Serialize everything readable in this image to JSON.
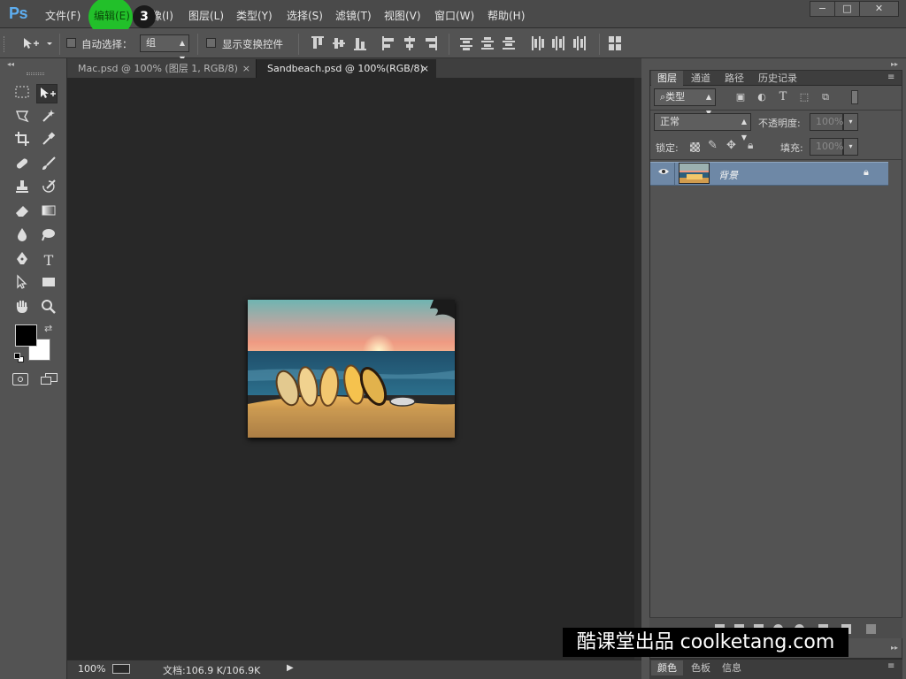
{
  "app": {
    "logo": "Ps"
  },
  "menu": [
    "文件(F)",
    "编辑(E)",
    "图像(I)",
    "图层(L)",
    "类型(Y)",
    "选择(S)",
    "滤镜(T)",
    "视图(V)",
    "窗口(W)",
    "帮助(H)"
  ],
  "tutorial": {
    "step_number": "3"
  },
  "window_controls": {
    "minimize": "−",
    "restore": "□",
    "close": "✕"
  },
  "options_bar": {
    "auto_select_label": "自动选择：",
    "auto_select_checked": false,
    "target_value": "组",
    "show_transform_label": "显示变换控件",
    "show_transform_checked": false
  },
  "tools": [
    "move-tool",
    "rectangular-marquee-tool",
    "lasso-tool",
    "magic-wand-tool",
    "crop-tool",
    "eyedropper-tool",
    "spot-healing-tool",
    "brush-tool",
    "clone-stamp-tool",
    "history-brush-tool",
    "eraser-tool",
    "gradient-tool",
    "blur-tool",
    "dodge-tool",
    "pen-tool",
    "type-tool",
    "path-selection-tool",
    "rectangle-tool",
    "hand-tool",
    "zoom-tool"
  ],
  "colors": {
    "foreground": "#000000",
    "background": "#ffffff",
    "layer_selected": "#6e88a6",
    "highlight": "#22c02a"
  },
  "documents": {
    "tabs": [
      {
        "label": "Mac.psd @ 100% (图层 1, RGB/8)",
        "close": "×",
        "active": false
      },
      {
        "label": "Sandbeach.psd @ 100%(RGB/8)",
        "close": "×",
        "active": true
      }
    ]
  },
  "status": {
    "zoom": "100%",
    "doc_info": "文档:106.9 K/106.9K"
  },
  "panels": {
    "tabs": [
      "图层",
      "通道",
      "路径",
      "历史记录"
    ],
    "filter_kind": "类型",
    "blend_mode": "正常",
    "opacity_label": "不透明度:",
    "opacity_value": "100%",
    "lock_label": "锁定:",
    "fill_label": "填充:",
    "fill_value": "100%",
    "layers": [
      {
        "name": "背景",
        "visible": true,
        "locked": true
      }
    ],
    "bottom_tabs": [
      "颜色",
      "色板",
      "信息"
    ]
  },
  "watermark": "酷课堂出品 coolketang.com"
}
